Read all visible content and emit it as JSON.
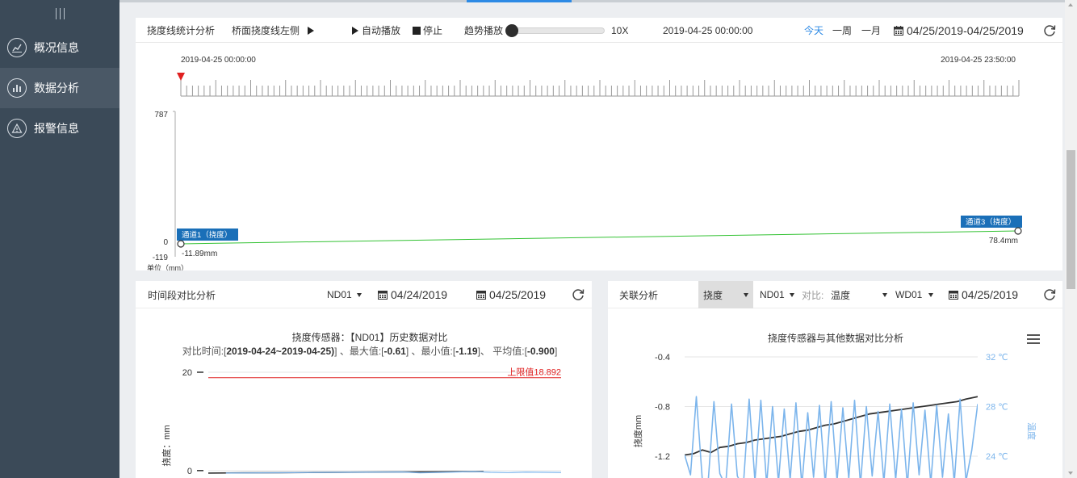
{
  "sidebar": {
    "items": [
      {
        "label": "概况信息",
        "icon": "trend-chart-icon",
        "active": false
      },
      {
        "label": "数据分析",
        "icon": "bar-chart-icon",
        "active": true
      },
      {
        "label": "报警信息",
        "icon": "warning-icon",
        "active": false
      }
    ]
  },
  "colors": {
    "accent": "#2d8ae5",
    "sidebar_bg": "#3b4a58",
    "sidebar_active": "#4a5866",
    "green_line": "#33c233",
    "red_limit": "#e02020",
    "blue_series": "#7cb5ec",
    "dark_series": "#333333",
    "tag_bg": "#1a6fb8"
  },
  "timeline_panel": {
    "title": "挠度线统计分析",
    "sub_title": "桥面挠度线左侧",
    "auto_play": "自动播放",
    "stop": "停止",
    "trend_play": "趋势播放",
    "speed": "10X",
    "current_time": "2019-04-25 00:00:00",
    "range_today": "今天",
    "range_week": "一周",
    "range_month": "一月",
    "date_range": "04/25/2019-04/25/2019",
    "start_time": "2019-04-25 00:00:00",
    "end_time": "2019-04-25 23:50:00",
    "y_max": "787",
    "y_zero": "0",
    "y_min": "-119",
    "unit": "单位（mm）",
    "ch1_tag": "通道1（挠度）",
    "ch1_value": "-11.89mm",
    "ch3_tag": "通道3（挠度）",
    "ch3_value": "78.4mm"
  },
  "period_panel": {
    "title": "时间段对比分析",
    "sensor": "ND01",
    "date1": "04/24/2019",
    "date2": "04/25/2019",
    "chart_data": {
      "type": "line",
      "title": "挠度传感器：【ND01】历史数据对比",
      "subtitle_prefix": "对比时间:[",
      "subtitle_range": "2019-04-24~2019-04-25)",
      "subtitle_mid1": "] 、最大值:[",
      "subtitle_max": "-0.61",
      "subtitle_mid2": "] 、最小值:[",
      "subtitle_min": "-1.19",
      "subtitle_mid3": "]、 平均值:[",
      "subtitle_avg": "-0.900",
      "subtitle_end": "]",
      "ylabel": "挠度：mm",
      "y_ticks": [
        "20",
        "0"
      ],
      "ylim": [
        -2,
        20
      ],
      "limit_label": "上限值18.892",
      "limit_value": 18.892,
      "series": [
        {
          "name": "",
          "color": "#333333",
          "x": [
            0,
            0.1,
            0.2,
            0.3,
            0.4,
            0.5,
            0.6,
            0.7,
            0.78
          ],
          "values": [
            -0.5,
            -0.45,
            -0.42,
            -0.38,
            -0.33,
            -0.3,
            -0.26,
            -0.22,
            -0.2
          ]
        },
        {
          "name": "",
          "color": "#7cb5ec",
          "x": [
            0.05,
            0.2,
            0.35,
            0.5,
            0.55,
            0.6,
            0.7,
            0.75,
            0.8,
            0.85,
            0.9,
            0.95,
            1.0
          ],
          "values": [
            -0.5,
            -0.44,
            -0.36,
            -0.3,
            -0.28,
            -0.45,
            -0.3,
            -0.2,
            -0.35,
            -0.4,
            -0.3,
            -0.35,
            -0.38
          ]
        }
      ]
    }
  },
  "correlation_panel": {
    "title": "关联分析",
    "metric": "挠度",
    "sensor": "ND01",
    "compare_label": "对比:",
    "compare_metric": "温度",
    "compare_sensor": "WD01",
    "date": "04/25/2019",
    "chart_data": {
      "type": "line",
      "title": "挠度传感器与其他数据对比分析",
      "ylabel_left": "挠度mm",
      "ylabel_right": "温度",
      "left_ticks": [
        "-0.4",
        "-0.8",
        "-1.2"
      ],
      "right_ticks": [
        "32 ℃",
        "28 ℃",
        "24 ℃"
      ],
      "ylim_left": [
        -1.2,
        -0.4
      ],
      "ylim_right": [
        24,
        32
      ],
      "series": [
        {
          "name": "",
          "axis": "left",
          "color": "#333333",
          "x": [
            0,
            0.03,
            0.06,
            0.09,
            0.12,
            0.15,
            0.18,
            0.21,
            0.24,
            0.27,
            0.3,
            0.33,
            0.36,
            0.39,
            0.42,
            0.45,
            0.48,
            0.51,
            0.54,
            0.57,
            0.6,
            0.63,
            0.66,
            0.69,
            0.72,
            0.75,
            0.78,
            0.81,
            0.84,
            0.87,
            0.9,
            0.93,
            0.96,
            1.0
          ],
          "values": [
            -1.19,
            -1.18,
            -1.15,
            -1.17,
            -1.13,
            -1.12,
            -1.1,
            -1.09,
            -1.07,
            -1.06,
            -1.05,
            -1.04,
            -1.02,
            -1.0,
            -0.99,
            -0.97,
            -0.95,
            -0.94,
            -0.92,
            -0.9,
            -0.88,
            -0.86,
            -0.85,
            -0.84,
            -0.83,
            -0.82,
            -0.81,
            -0.8,
            -0.79,
            -0.78,
            -0.77,
            -0.76,
            -0.74,
            -0.72
          ]
        },
        {
          "name": "",
          "axis": "right",
          "color": "#7cb5ec",
          "x": [
            0,
            0.02,
            0.04,
            0.06,
            0.08,
            0.1,
            0.12,
            0.14,
            0.16,
            0.18,
            0.2,
            0.22,
            0.24,
            0.26,
            0.28,
            0.3,
            0.32,
            0.34,
            0.36,
            0.38,
            0.4,
            0.42,
            0.44,
            0.46,
            0.48,
            0.5,
            0.52,
            0.54,
            0.56,
            0.58,
            0.6,
            0.62,
            0.64,
            0.66,
            0.68,
            0.7,
            0.72,
            0.74,
            0.76,
            0.78,
            0.8,
            0.82,
            0.84,
            0.86,
            0.88,
            0.9,
            0.92,
            0.94,
            0.96,
            0.98,
            1.0
          ],
          "values": [
            24.1,
            22.5,
            28.8,
            22.2,
            21.8,
            28.4,
            22.6,
            21.6,
            28.2,
            22.4,
            21.5,
            28.6,
            22.0,
            28.5,
            21.7,
            28.0,
            21.9,
            27.8,
            22.1,
            28.3,
            21.6,
            27.5,
            22.3,
            28.1,
            21.8,
            28.4,
            22.0,
            27.9,
            22.2,
            28.5,
            21.7,
            28.0,
            22.4,
            27.6,
            21.9,
            28.2,
            22.1,
            27.8,
            21.6,
            28.3,
            22.5,
            27.7,
            21.8,
            28.1,
            22.3,
            27.4,
            21.9,
            28.6,
            22.0,
            24.5,
            28.2
          ]
        }
      ]
    }
  }
}
